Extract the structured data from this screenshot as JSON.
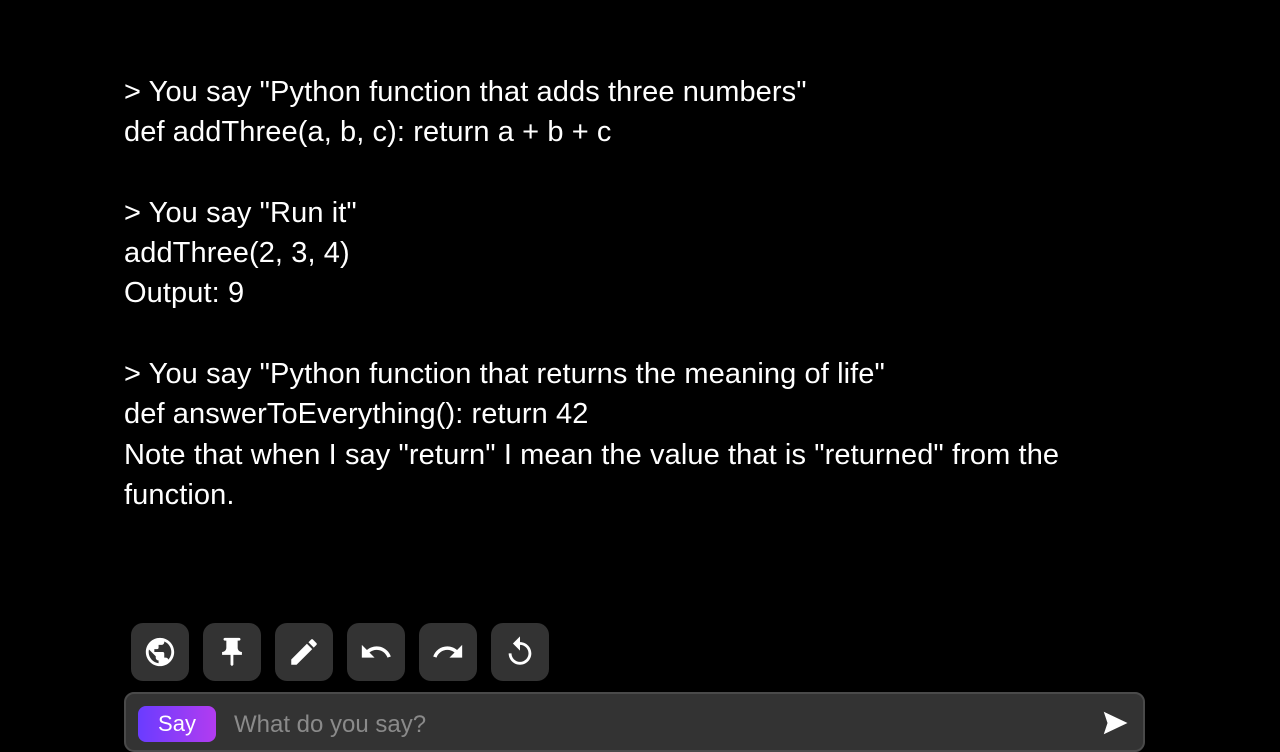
{
  "story": {
    "lines": [
      "> You say \"Python function that adds three numbers\"",
      "def addThree(a, b, c): return a + b + c",
      "",
      "> You say \"Run it\"",
      "addThree(2, 3, 4)",
      "Output: 9",
      "",
      "> You say \"Python function that returns the meaning of life\"",
      "def answerToEverything(): return 42",
      "Note that when I say \"return\" I mean the value that is \"returned\" from the function."
    ]
  },
  "toolbar": {
    "buttons": [
      {
        "icon": "globe-icon"
      },
      {
        "icon": "pin-icon"
      },
      {
        "icon": "pencil-icon"
      },
      {
        "icon": "undo-icon"
      },
      {
        "icon": "redo-icon"
      },
      {
        "icon": "retry-icon"
      }
    ]
  },
  "input": {
    "mode_label": "Say",
    "placeholder": "What do you say?",
    "value": ""
  },
  "colors": {
    "background": "#000000",
    "text": "#ffffff",
    "button_bg": "#333333",
    "mode_gradient_start": "#6a3cff",
    "mode_gradient_end": "#b23cf0"
  }
}
